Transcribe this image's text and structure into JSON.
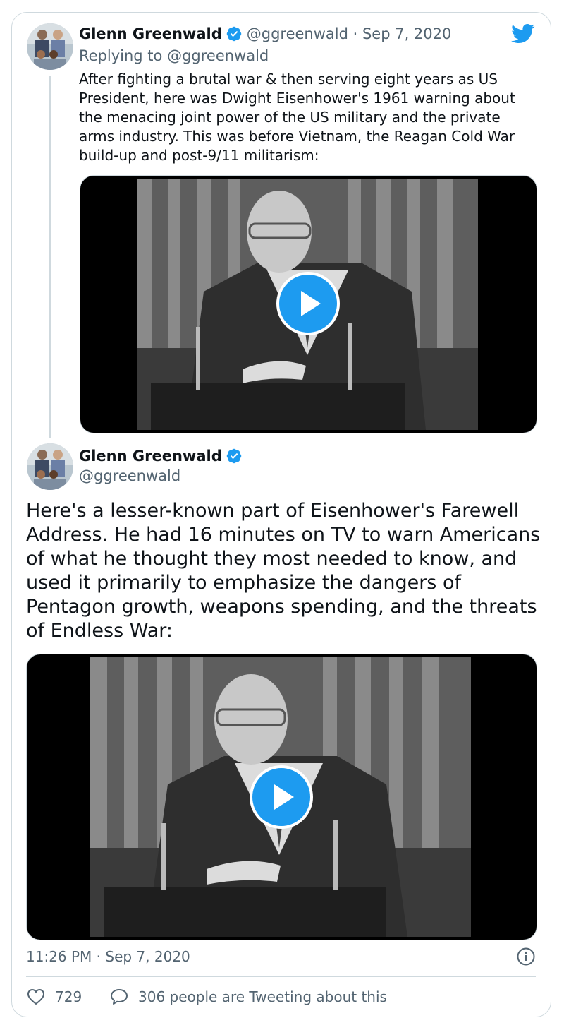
{
  "colors": {
    "accent": "#1d9bf0",
    "text_primary": "#0f1419",
    "text_secondary": "#536471",
    "border": "#cfd9de"
  },
  "tweet1": {
    "author_name": "Glenn Greenwald",
    "handle_date": "@ggreenwald · Sep 7, 2020",
    "replying_to": "Replying to @ggreenwald",
    "text": "After fighting a brutal war & then serving eight years as US President, here was Dwight Eisenhower's 1961 warning about the menacing joint power of the US military and the private arms industry. This was before Vietnam, the Reagan Cold War build-up and post-9/11 militarism:",
    "media_icon": "play-icon"
  },
  "tweet2": {
    "author_name": "Glenn Greenwald",
    "handle": "@ggreenwald",
    "text": "Here's a lesser-known part of Eisenhower's Farewell Address. He had 16 minutes on TV to warn Americans of what he thought they most needed to know, and used it primarily to emphasize the dangers of Pentagon growth, weapons spending, and the threats of Endless War:",
    "media_icon": "play-icon",
    "timestamp": "11:26 PM · Sep 7, 2020"
  },
  "actions": {
    "likes": "729",
    "conversation": "306 people are Tweeting about this"
  },
  "icons": {
    "logo": "twitter-bird-icon",
    "verified": "verified-badge-icon",
    "info": "info-icon",
    "like": "heart-icon",
    "reply": "speech-bubble-icon"
  }
}
